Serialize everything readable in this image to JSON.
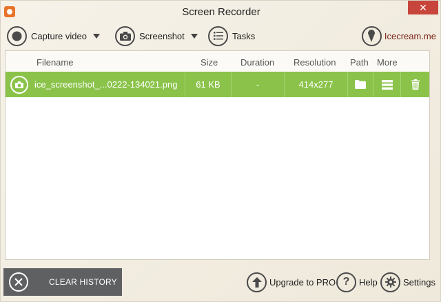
{
  "window": {
    "title": "Screen Recorder",
    "close_glyph": "✕"
  },
  "toolbar": {
    "capture_video_label": "Capture video",
    "screenshot_label": "Screenshot",
    "tasks_label": "Tasks",
    "brand_label": "Icecream.me"
  },
  "table": {
    "columns": [
      "Filename",
      "Size",
      "Duration",
      "Resolution",
      "Path",
      "More"
    ],
    "rows": [
      {
        "filename": "ice_screenshot_...0222-134021.png",
        "size": "61 KB",
        "duration": "-",
        "resolution": "414x277"
      }
    ]
  },
  "footer": {
    "clear_history_label": "CLEAR HISTORY",
    "upgrade_label": "Upgrade to PRO",
    "help_label": "Help",
    "settings_label": "Settings"
  },
  "colors": {
    "row_highlight": "#8bc34a",
    "clear_button": "#5f6062",
    "close_button": "#c7453b",
    "brand_text": "#7a1f16"
  }
}
